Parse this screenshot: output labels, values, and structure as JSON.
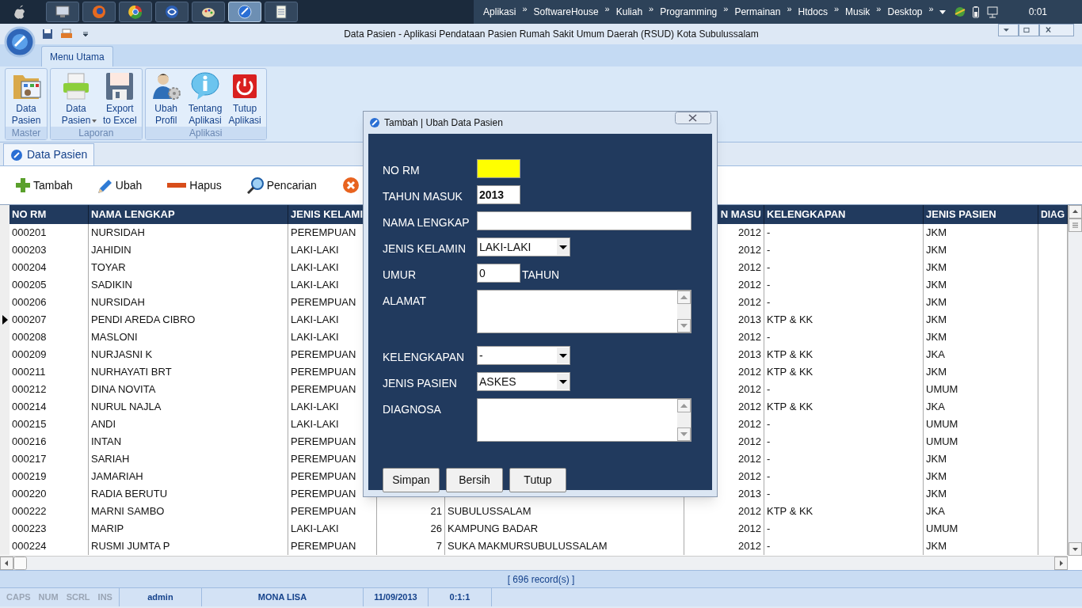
{
  "taskbar": {
    "apps": [
      {
        "kind": "monitor",
        "selected": false
      },
      {
        "kind": "fox",
        "selected": false
      },
      {
        "kind": "chrome",
        "selected": false
      },
      {
        "kind": "swirl",
        "selected": false
      },
      {
        "kind": "palette",
        "selected": false
      },
      {
        "kind": "orb",
        "selected": true
      },
      {
        "kind": "notepad",
        "selected": false
      }
    ],
    "links": [
      "Aplikasi",
      "SoftwareHouse",
      "Kuliah",
      "Programming",
      "Permainan",
      "Htdocs",
      "Musik",
      "Desktop"
    ],
    "separator": "»",
    "clock": "0:01"
  },
  "window": {
    "title": "Data Pasien - Aplikasi Pendataan Pasien Rumah Sakit Umum Daerah (RSUD) Kota Subulussalam"
  },
  "ribbon": {
    "tabs": [
      {
        "label": "Menu Utama",
        "selected": true
      }
    ],
    "groups": [
      {
        "label": "Master",
        "buttons": [
          {
            "label": "Data\nPasien",
            "kind": "folder",
            "dropdown": false
          }
        ]
      },
      {
        "label": "Laporan",
        "buttons": [
          {
            "label": "Data\nPasien",
            "kind": "printer",
            "dropdown": true
          },
          {
            "label": "Export\nto Excel",
            "kind": "floppy",
            "dropdown": false
          }
        ]
      },
      {
        "label": "Aplikasi",
        "buttons": [
          {
            "label": "Ubah\nProfil",
            "kind": "user",
            "dropdown": false
          },
          {
            "label": "Tentang\nAplikasi",
            "kind": "info",
            "dropdown": false
          },
          {
            "label": "Tutup\nAplikasi",
            "kind": "power",
            "dropdown": false
          }
        ]
      }
    ]
  },
  "document_tabs": [
    {
      "label": "Data Pasien",
      "selected": true
    }
  ],
  "toolbar": [
    {
      "label": "Tambah",
      "kind": "plus"
    },
    {
      "label": "Ubah",
      "kind": "pencil"
    },
    {
      "label": "Hapus",
      "kind": "minus"
    },
    {
      "label": "Pencarian",
      "kind": "search"
    },
    {
      "kind": "cancel"
    }
  ],
  "table": {
    "columns": [
      "NO RM",
      "NAMA LENGKAP",
      "JENIS KELAMI",
      null,
      null,
      "N MASU",
      "KELENGKAPAN",
      "JENIS PASIEN",
      "DIAG"
    ],
    "rows": [
      {
        "selected": false,
        "no_rm": "000201",
        "nama_lengkap": "NURSIDAH",
        "jenis_kelamin": "PEREMPUAN",
        "tahun_masuk": "2012",
        "kelengkapan": "-",
        "jenis_pasien": "JKM"
      },
      {
        "selected": false,
        "no_rm": "000203",
        "nama_lengkap": "JAHIDIN",
        "jenis_kelamin": "LAKI-LAKI",
        "tahun_masuk": "2012",
        "kelengkapan": "-",
        "jenis_pasien": "JKM"
      },
      {
        "selected": false,
        "no_rm": "000204",
        "nama_lengkap": "TOYAR",
        "jenis_kelamin": "LAKI-LAKI",
        "tahun_masuk": "2012",
        "kelengkapan": "-",
        "jenis_pasien": "JKM"
      },
      {
        "selected": false,
        "no_rm": "000205",
        "nama_lengkap": "SADIKIN",
        "jenis_kelamin": "LAKI-LAKI",
        "tahun_masuk": "2012",
        "kelengkapan": "-",
        "jenis_pasien": "JKM"
      },
      {
        "selected": false,
        "no_rm": "000206",
        "nama_lengkap": "NURSIDAH",
        "jenis_kelamin": "PEREMPUAN",
        "tahun_masuk": "2012",
        "kelengkapan": "-",
        "jenis_pasien": "JKM"
      },
      {
        "selected": true,
        "no_rm": "000207",
        "nama_lengkap": "PENDI AREDA CIBRO",
        "jenis_kelamin": "LAKI-LAKI",
        "tahun_masuk": "2013",
        "kelengkapan": "KTP & KK",
        "jenis_pasien": "JKM"
      },
      {
        "selected": false,
        "no_rm": "000208",
        "nama_lengkap": "MASLONI",
        "jenis_kelamin": "LAKI-LAKI",
        "tahun_masuk": "2012",
        "kelengkapan": "-",
        "jenis_pasien": "JKM"
      },
      {
        "selected": false,
        "no_rm": "000209",
        "nama_lengkap": "NURJASNI K",
        "jenis_kelamin": "PEREMPUAN",
        "tahun_masuk": "2013",
        "kelengkapan": "KTP & KK",
        "jenis_pasien": "JKA"
      },
      {
        "selected": false,
        "no_rm": "000211",
        "nama_lengkap": "NURHAYATI BRT",
        "jenis_kelamin": "PEREMPUAN",
        "tahun_masuk": "2012",
        "kelengkapan": "KTP & KK",
        "jenis_pasien": "JKM"
      },
      {
        "selected": false,
        "no_rm": "000212",
        "nama_lengkap": "DINA NOVITA",
        "jenis_kelamin": "PEREMPUAN",
        "tahun_masuk": "2012",
        "kelengkapan": "-",
        "jenis_pasien": "UMUM"
      },
      {
        "selected": false,
        "no_rm": "000214",
        "nama_lengkap": "NURUL NAJLA",
        "jenis_kelamin": "LAKI-LAKI",
        "tahun_masuk": "2012",
        "kelengkapan": "KTP & KK",
        "jenis_pasien": "JKA"
      },
      {
        "selected": false,
        "no_rm": "000215",
        "nama_lengkap": "ANDI",
        "jenis_kelamin": "LAKI-LAKI",
        "tahun_masuk": "2012",
        "kelengkapan": "-",
        "jenis_pasien": "UMUM"
      },
      {
        "selected": false,
        "no_rm": "000216",
        "nama_lengkap": "INTAN",
        "jenis_kelamin": "PEREMPUAN",
        "tahun_masuk": "2012",
        "kelengkapan": "-",
        "jenis_pasien": "UMUM"
      },
      {
        "selected": false,
        "no_rm": "000217",
        "nama_lengkap": "SARIAH",
        "jenis_kelamin": "PEREMPUAN",
        "tahun_masuk": "2012",
        "kelengkapan": "-",
        "jenis_pasien": "JKM"
      },
      {
        "selected": false,
        "no_rm": "000219",
        "nama_lengkap": "JAMARIAH",
        "jenis_kelamin": "PEREMPUAN",
        "tahun_masuk": "2012",
        "kelengkapan": "-",
        "jenis_pasien": "JKM"
      },
      {
        "selected": false,
        "no_rm": "000220",
        "nama_lengkap": "RADIA BERUTU",
        "jenis_kelamin": "PEREMPUAN",
        "tahun_masuk": "2013",
        "kelengkapan": "-",
        "jenis_pasien": "JKM"
      },
      {
        "selected": false,
        "no_rm": "000222",
        "nama_lengkap": "MARNI SAMBO",
        "jenis_kelamin": "PEREMPUAN",
        "column_4": "21",
        "column_5": "SUBULUSSALAM",
        "tahun_masuk": "2012",
        "kelengkapan": "KTP & KK",
        "jenis_pasien": "JKA"
      },
      {
        "selected": false,
        "no_rm": "000223",
        "nama_lengkap": "MARIP",
        "jenis_kelamin": "LAKI-LAKI",
        "column_4": "26",
        "column_5": "KAMPUNG BADAR",
        "tahun_masuk": "2012",
        "kelengkapan": "-",
        "jenis_pasien": "UMUM"
      },
      {
        "selected": false,
        "no_rm": "000224",
        "nama_lengkap": "RUSMI JUMTA P",
        "jenis_kelamin": "PEREMPUAN",
        "column_4": "7",
        "column_5": "SUKA MAKMURSUBULUSSALAM",
        "tahun_masuk": "2012",
        "kelengkapan": "-",
        "jenis_pasien": "JKM"
      }
    ]
  },
  "record_count": "[ 696 record(s) ]",
  "status_bar": {
    "indicators": [
      {
        "label": "CAPS",
        "on": false
      },
      {
        "label": "NUM",
        "on": false
      },
      {
        "label": "SCRL",
        "on": false
      },
      {
        "label": "INS",
        "on": false
      }
    ],
    "user": "admin",
    "name": "MONA LISA",
    "date": "11/09/2013",
    "time": "0:1:1"
  },
  "dialog": {
    "title": "Tambah | Ubah Data Pasien",
    "fields": [
      {
        "label": "NO RM",
        "kind": "short_text",
        "focused": true
      },
      {
        "label": "TAHUN MASUK",
        "kind": "short_text",
        "value": "2013",
        "focused": false,
        "bold": true
      },
      {
        "label": "NAMA LENGKAP",
        "kind": "long_text",
        "focused": false
      },
      {
        "label": "JENIS KELAMIN",
        "kind": "select",
        "value": "LAKI-LAKI",
        "focused": false,
        "bold": false
      },
      {
        "label": "UMUR",
        "kind": "short_text",
        "value": "0",
        "suffix": "TAHUN",
        "focused": false,
        "bold": false
      },
      {
        "label": "ALAMAT",
        "kind": "textarea",
        "focused": false
      },
      {
        "label": "KELENGKAPAN",
        "kind": "select",
        "value": "-",
        "focused": false,
        "bold": false
      },
      {
        "label": "JENIS PASIEN",
        "kind": "select",
        "value": "ASKES",
        "focused": false,
        "bold": false
      },
      {
        "label": "DIAGNOSA",
        "kind": "textarea",
        "focused": false
      }
    ],
    "buttons": [
      "Simpan",
      "Bersih",
      "Tutup"
    ]
  }
}
